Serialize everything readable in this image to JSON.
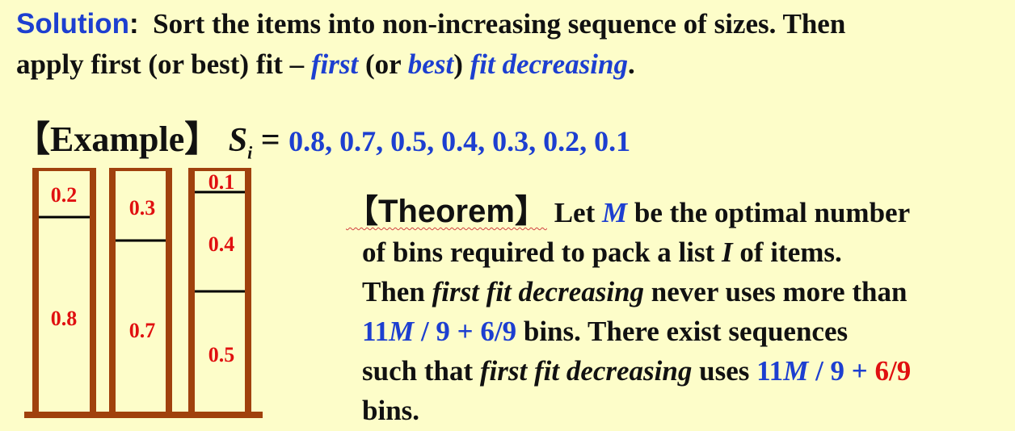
{
  "solution": {
    "label": "Solution",
    "colon": ":",
    "text1": "Sort the items into non-increasing sequence of sizes.  Then",
    "text2a": "apply first (or best) fit – ",
    "first": "first",
    "paren_open": " (or ",
    "best": "best",
    "paren_close": ") ",
    "fit_decreasing": "fit decreasing",
    "period": "."
  },
  "example": {
    "label": "【Example】",
    "var": "S",
    "sub": "i",
    "equals": " = ",
    "sequence": "0.8, 0.7, 0.5, 0.4, 0.3, 0.2, 0.1"
  },
  "bins": [
    {
      "items": [
        "0.8",
        "0.2"
      ]
    },
    {
      "items": [
        "0.7",
        "0.3"
      ]
    },
    {
      "items": [
        "0.5",
        "0.4",
        "0.1"
      ]
    }
  ],
  "theorem": {
    "label": "【Theorem】",
    "l1a": " Let ",
    "M": "M",
    "l1b": " be the optimal number",
    "l2a": "of bins required to pack a list ",
    "I": "I",
    "l2b": " of items.",
    "l3a": "Then ",
    "ffd": "first fit decreasing",
    "l3b": " never uses more than",
    "eleven": "11",
    "over9": " / 9 + 6/9",
    "l4b": " bins.  There exist sequences",
    "l5a": "such that ",
    "ffd2": "first fit decreasing",
    "l5b": " uses ",
    "eleven2": "11",
    "over9b": " / 9 + ",
    "sixninths": "6/9",
    "l6": "bins."
  },
  "colors": {
    "background": "#fdfdc9",
    "blue": "#1d3fd0",
    "red": "#e01010",
    "bin": "#a0410d"
  }
}
